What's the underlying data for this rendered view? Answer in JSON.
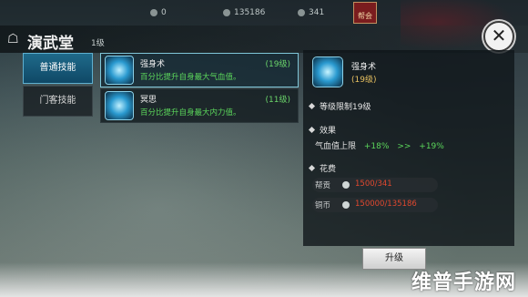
{
  "topbar": {
    "res1": "0",
    "res2": "135186",
    "res3": "341",
    "gang_label": "帮会"
  },
  "header": {
    "title": "演武堂",
    "level": "1级"
  },
  "tabs": [
    {
      "label": "普通技能",
      "active": true
    },
    {
      "label": "门客技能",
      "active": false
    }
  ],
  "skills": [
    {
      "name": "强身术",
      "level": "(19级)",
      "desc": "百分比提升自身最大气血值。"
    },
    {
      "name": "冥思",
      "level": "(11级)",
      "desc": "百分比提升自身最大内力值。"
    }
  ],
  "detail": {
    "name": "强身术",
    "level": "(19级)",
    "level_limit": "等级限制19级",
    "effect_title": "效果",
    "effect_label": "气血值上限",
    "effect_from": "+18%",
    "arrow": ">>",
    "effect_to": "+19%",
    "cost_title": "花费",
    "costs": [
      {
        "label": "帮贡",
        "value": "1500/341"
      },
      {
        "label": "铜币",
        "value": "150000/135186"
      }
    ],
    "upgrade_label": "升级"
  },
  "watermark": "维普手游网",
  "colors": {
    "accent_green": "#5bd65b",
    "cost_red": "#e0482f",
    "level_gold": "#e6c060",
    "tab_active": "#1f6a8a"
  }
}
